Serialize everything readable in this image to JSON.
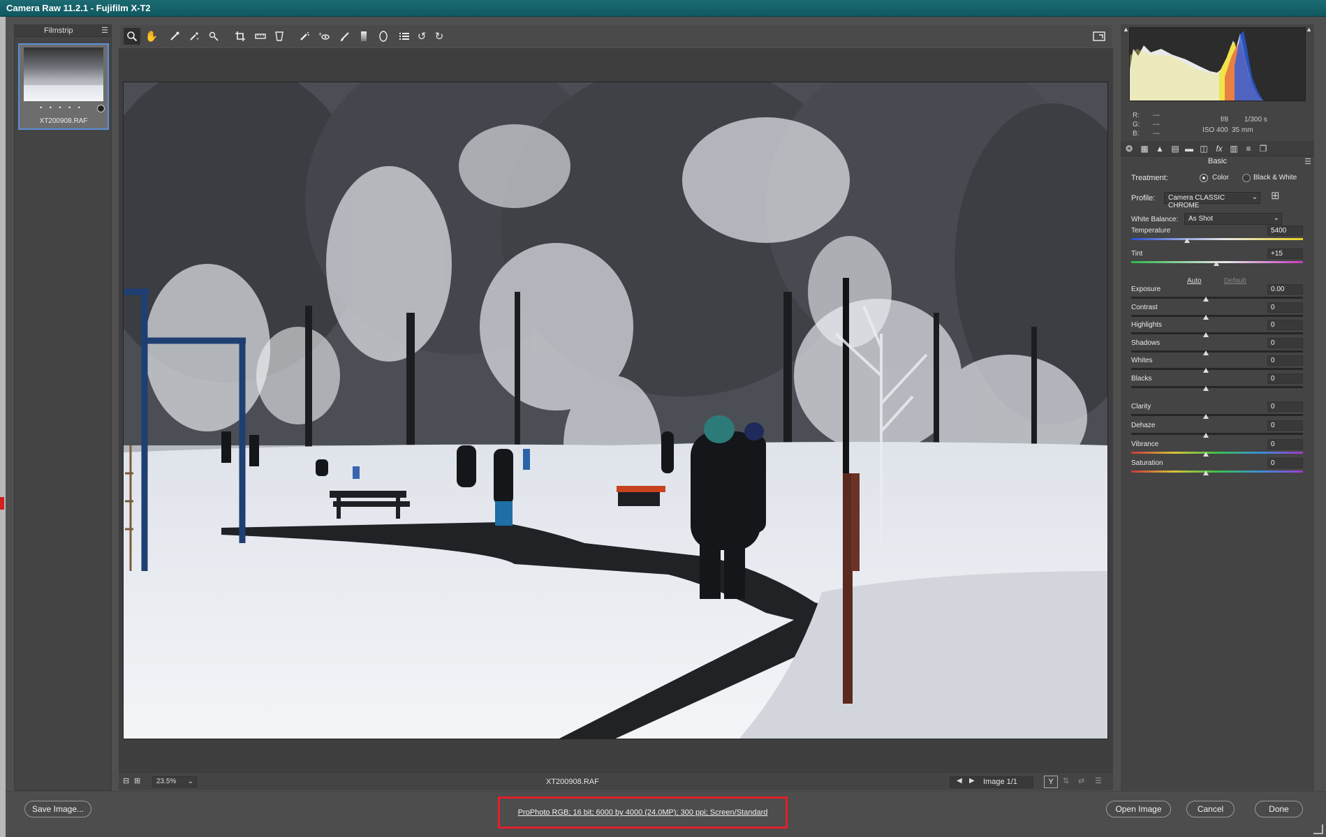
{
  "window": {
    "title": "Camera Raw 11.2.1  -  Fujifilm X-T2"
  },
  "filmstrip": {
    "title": "Filmstrip",
    "menu_icon": "panel-menu-icon",
    "thumbnail": {
      "name": "XT200908.RAF",
      "rating": "• • • • •"
    }
  },
  "toolbar": {
    "tools": [
      "zoom-tool-icon",
      "hand-tool-icon",
      "white-balance-tool-icon",
      "color-sampler-tool-icon",
      "targeted-adjustment-tool-icon",
      "crop-tool-icon",
      "straighten-tool-icon",
      "transform-tool-icon",
      "spot-removal-tool-icon",
      "red-eye-removal-tool-icon",
      "adjustment-brush-icon",
      "graduated-filter-icon",
      "radial-filter-icon",
      "preferences-icon",
      "rotate-ccw-icon",
      "rotate-cw-icon"
    ],
    "fullscreen_icon": "toggle-fullscreen-icon"
  },
  "status": {
    "zoom": "23.5%",
    "filename": "XT200908.RAF",
    "image_count": "Image 1/1",
    "before_after": "Y"
  },
  "readout": {
    "r_label": "R:",
    "g_label": "G:",
    "b_label": "B:",
    "r": "---",
    "g": "---",
    "b": "---",
    "aperture": "f/8",
    "shutter": "1/300 s",
    "iso": "ISO 400",
    "focal": "35 mm"
  },
  "panel": {
    "title": "Basic",
    "treatment_label": "Treatment:",
    "treatment_color": "Color",
    "treatment_bw": "Black & White",
    "treatment_selected": "Color",
    "profile_label": "Profile:",
    "profile_value": "Camera CLASSIC CHROME",
    "wb_label": "White Balance:",
    "wb_value": "As Shot",
    "auto": "Auto",
    "default": "Default",
    "sliders": [
      {
        "label": "Temperature",
        "value": "5400"
      },
      {
        "label": "Tint",
        "value": "+15"
      },
      {
        "label": "Exposure",
        "value": "0.00"
      },
      {
        "label": "Contrast",
        "value": "0"
      },
      {
        "label": "Highlights",
        "value": "0"
      },
      {
        "label": "Shadows",
        "value": "0"
      },
      {
        "label": "Whites",
        "value": "0"
      },
      {
        "label": "Blacks",
        "value": "0"
      },
      {
        "label": "Clarity",
        "value": "0"
      },
      {
        "label": "Dehaze",
        "value": "0"
      },
      {
        "label": "Vibrance",
        "value": "0"
      },
      {
        "label": "Saturation",
        "value": "0"
      }
    ]
  },
  "bottom": {
    "save": "Save Image...",
    "workflow": "ProPhoto RGB; 16 bit; 6000 by 4000 (24.0MP); 300 ppi; Screen/Standard",
    "open": "Open Image",
    "cancel": "Cancel",
    "done": "Done"
  },
  "colors": {
    "titlebar": "#12636b",
    "highlight_frame": "#e0202a",
    "accent": "#5a8fd8"
  }
}
